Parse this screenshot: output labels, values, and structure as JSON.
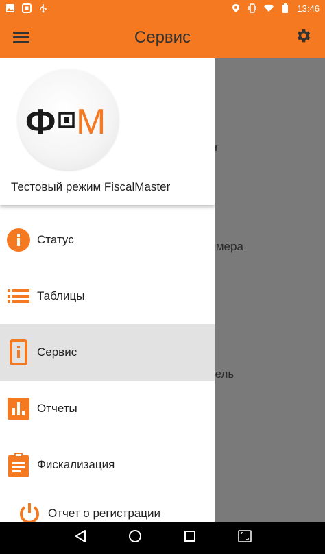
{
  "status_bar": {
    "time": "13:46",
    "icons_left": [
      "image-icon",
      "screenshot-icon",
      "usb-icon"
    ],
    "icons_right": [
      "location-icon",
      "vibrate-icon",
      "wifi-icon",
      "battery-icon"
    ]
  },
  "app_bar": {
    "title": "Сервис",
    "menu_icon": "hamburger-menu-icon",
    "settings_icon": "gear-icon"
  },
  "background_items": [
    "мя",
    "номера",
    "тель"
  ],
  "drawer": {
    "logo_text": "Ф▪М",
    "header_title": "Тестовый режим FiscalMaster",
    "items": [
      {
        "label": "Статус",
        "icon": "info-icon"
      },
      {
        "label": "Таблицы",
        "icon": "list-icon"
      },
      {
        "label": "Сервис",
        "icon": "device-icon",
        "active": true
      },
      {
        "label": "Отчеты",
        "icon": "bar-chart-icon"
      },
      {
        "label": "Фискализация",
        "icon": "clipboard-icon"
      },
      {
        "label": "Отчет о регистрации",
        "icon": "power-icon"
      }
    ]
  },
  "colors": {
    "accent": "#f47920",
    "scrim": "#7a7a7a",
    "active_item": "#e2e2e2"
  }
}
